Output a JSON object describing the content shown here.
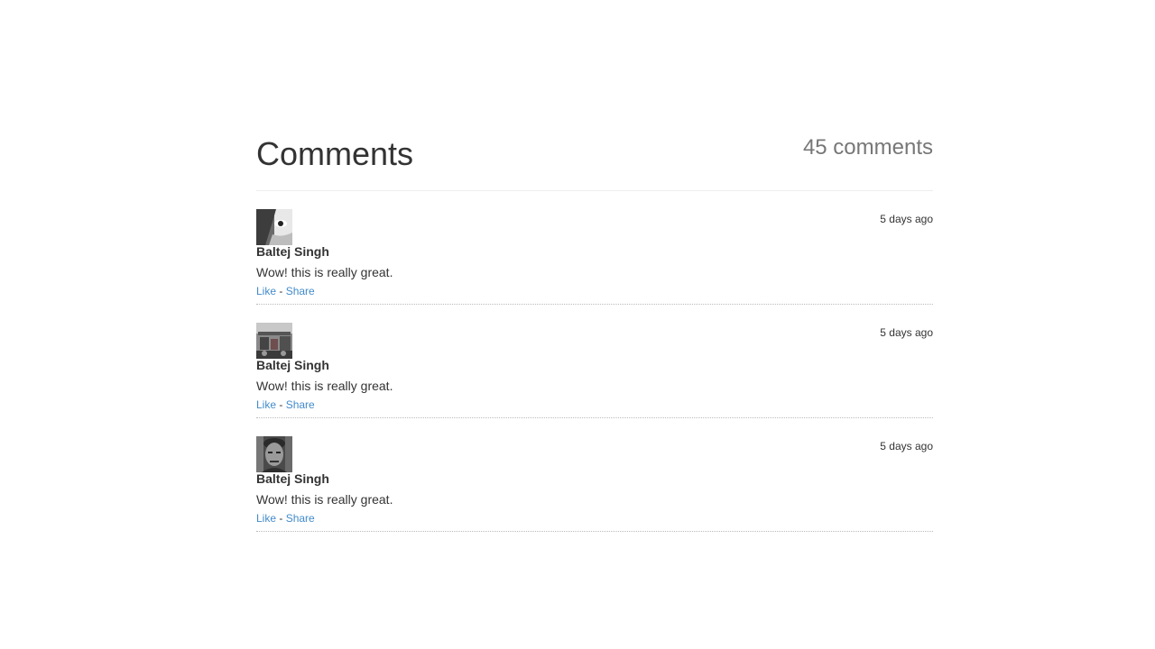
{
  "header": {
    "title": "Comments",
    "count_label": "45 comments"
  },
  "colors": {
    "link": "#428bca",
    "text": "#333333",
    "muted": "#777777"
  },
  "comments": [
    {
      "author": "Baltej Singh",
      "time": "5 days ago",
      "text": "Wow! this is really great.",
      "like_label": "Like",
      "separator": "-",
      "share_label": "Share",
      "avatar_icon": "avatar-photo-1"
    },
    {
      "author": "Baltej Singh",
      "time": "5 days ago",
      "text": "Wow! this is really great.",
      "like_label": "Like",
      "separator": "-",
      "share_label": "Share",
      "avatar_icon": "avatar-photo-2"
    },
    {
      "author": "Baltej Singh",
      "time": "5 days ago",
      "text": "Wow! this is really great.",
      "like_label": "Like",
      "separator": "-",
      "share_label": "Share",
      "avatar_icon": "avatar-photo-3"
    }
  ]
}
